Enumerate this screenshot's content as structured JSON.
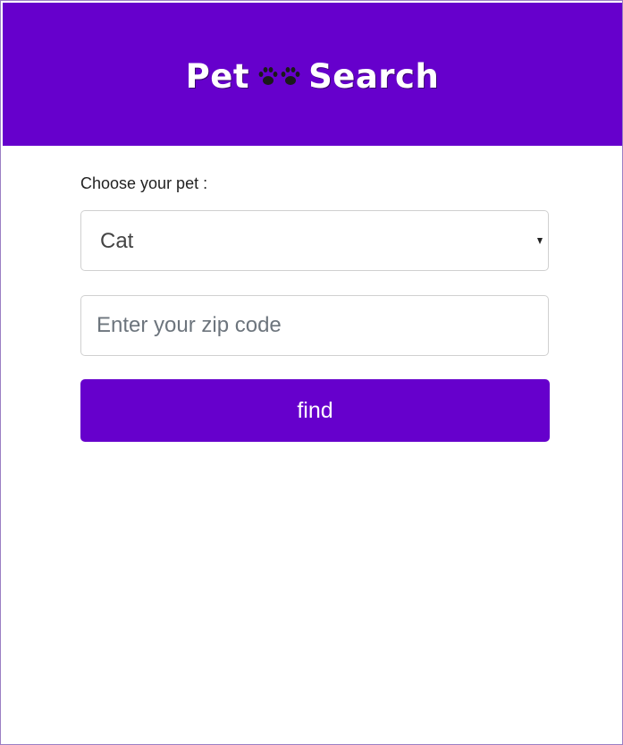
{
  "colors": {
    "brand": "#6600cc",
    "frame_border": "#9b7fc4"
  },
  "header": {
    "logo_left": "Pet",
    "logo_icon": "paw-prints-icon",
    "logo_right": "Search"
  },
  "form": {
    "pet_label": "Choose your pet :",
    "pet_select": {
      "selected": "Cat",
      "icon": "caret-down-icon"
    },
    "zip_input": {
      "value": "",
      "placeholder": "Enter your zip code"
    },
    "find_label": "find"
  }
}
